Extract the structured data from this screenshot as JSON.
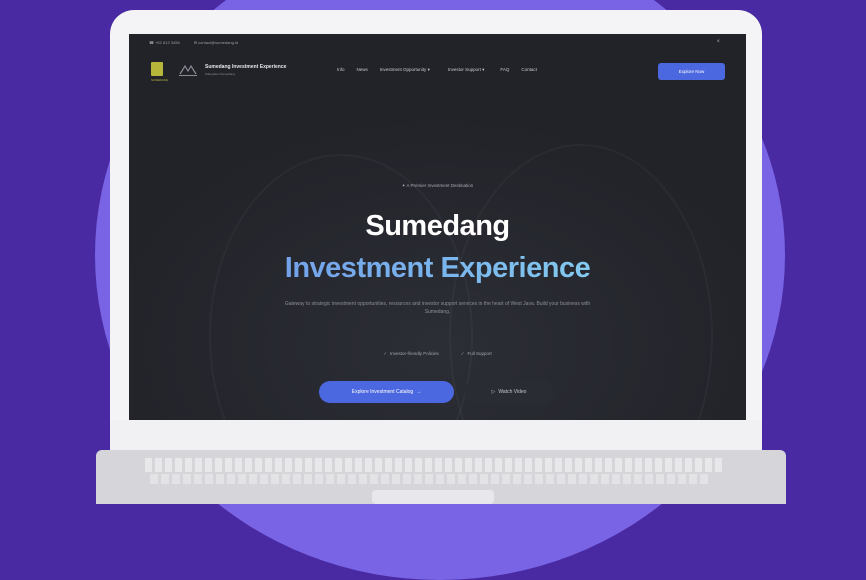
{
  "topbar": {
    "phone": "+62 812 3456",
    "email": "contact@sumedang.id",
    "close_icon": "×"
  },
  "nav": {
    "brand_name": "Sumedang Investment Experience",
    "brand_tagline": "Kabupaten Sumedang",
    "logo_caption": "SUMEDANG",
    "links": [
      "Info",
      "News",
      "Investment Opportunity",
      "Investor Support",
      "FAQ",
      "Contact"
    ],
    "cta": "Explore Now"
  },
  "hero": {
    "pill": "A Premier Investment Destination",
    "title_line1": "Sumedang",
    "title_line2": "Investment Experience",
    "description": "Gateway to strategic investment opportunities, resources and investor support services in the heart of West Java. Build your business with Sumedang.",
    "features": [
      "Investor-friendly Policies",
      "Full Support"
    ],
    "primary_button": "Explore Investment Catalog",
    "secondary_button": "Watch Video"
  }
}
